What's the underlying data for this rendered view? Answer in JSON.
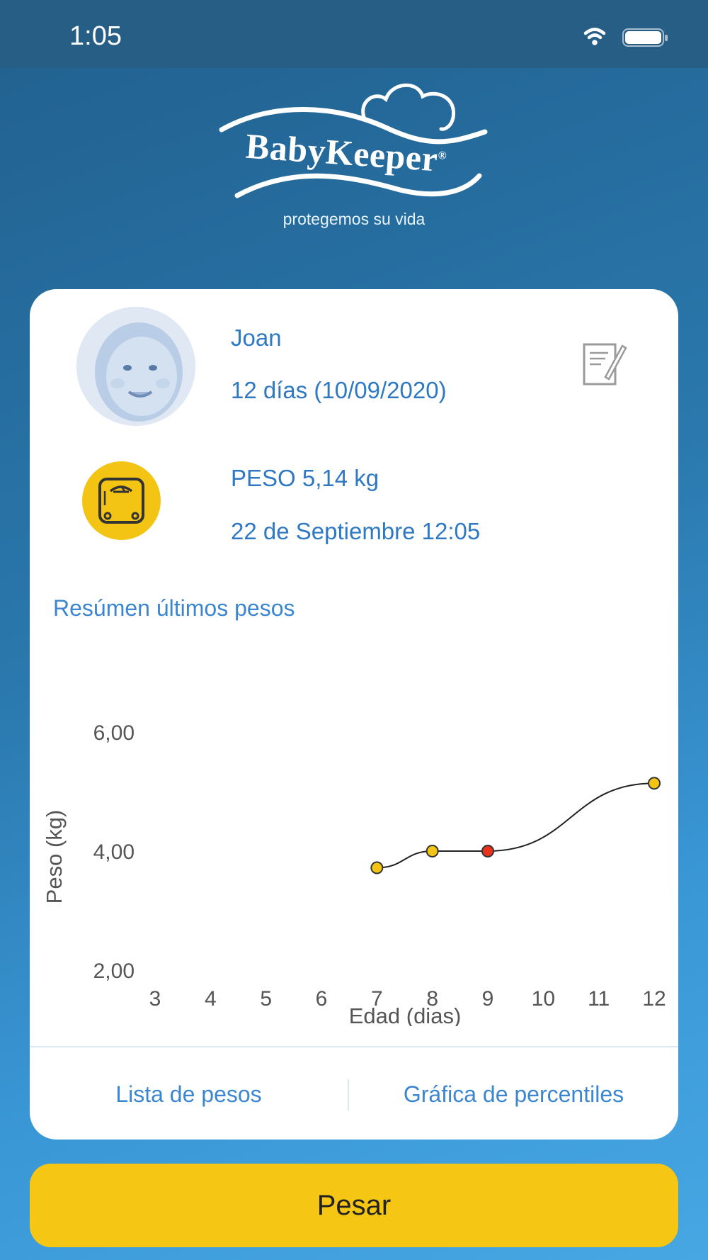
{
  "status_bar": {
    "time": "1:05",
    "icons": [
      "wifi-icon",
      "battery-icon"
    ]
  },
  "logo": {
    "brand": "BabyKeeper",
    "registered_mark": "®",
    "tagline": "protegemos su vida"
  },
  "profile": {
    "name": "Joan",
    "age": "12 días (10/09/2020)",
    "weight": "PESO 5,14 kg",
    "weight_date": "22 de Septiembre 12:05"
  },
  "summary": {
    "title": "Resúmen últimos pesos",
    "chart_data": {
      "type": "line",
      "xlabel": "Edad (dias)",
      "ylabel": "Peso (kg)",
      "x_ticks": [
        "3",
        "4",
        "5",
        "6",
        "7",
        "8",
        "9",
        "10",
        "11",
        "12"
      ],
      "y_ticks": [
        "2,00",
        "4,00",
        "6,00"
      ],
      "xlim": [
        3,
        12
      ],
      "ylim": [
        2,
        6
      ],
      "series": [
        {
          "points": [
            {
              "x": 7,
              "y": 3.72,
              "color": "#f4c414"
            },
            {
              "x": 8,
              "y": 4.0,
              "color": "#f4c414"
            },
            {
              "x": 9,
              "y": 4.0,
              "color": "#e8331c"
            },
            {
              "x": 12,
              "y": 5.14,
              "color": "#f4c414"
            }
          ]
        }
      ],
      "grid": false
    }
  },
  "links": {
    "weights_list": "Lista de pesos",
    "percentiles_chart": "Gráfica de percentiles"
  },
  "action": {
    "weigh_label": "Pesar"
  },
  "colors": {
    "accent_blue": "#2f79c4",
    "button_yellow": "#f5c613",
    "highlight_red": "#e8331c"
  }
}
